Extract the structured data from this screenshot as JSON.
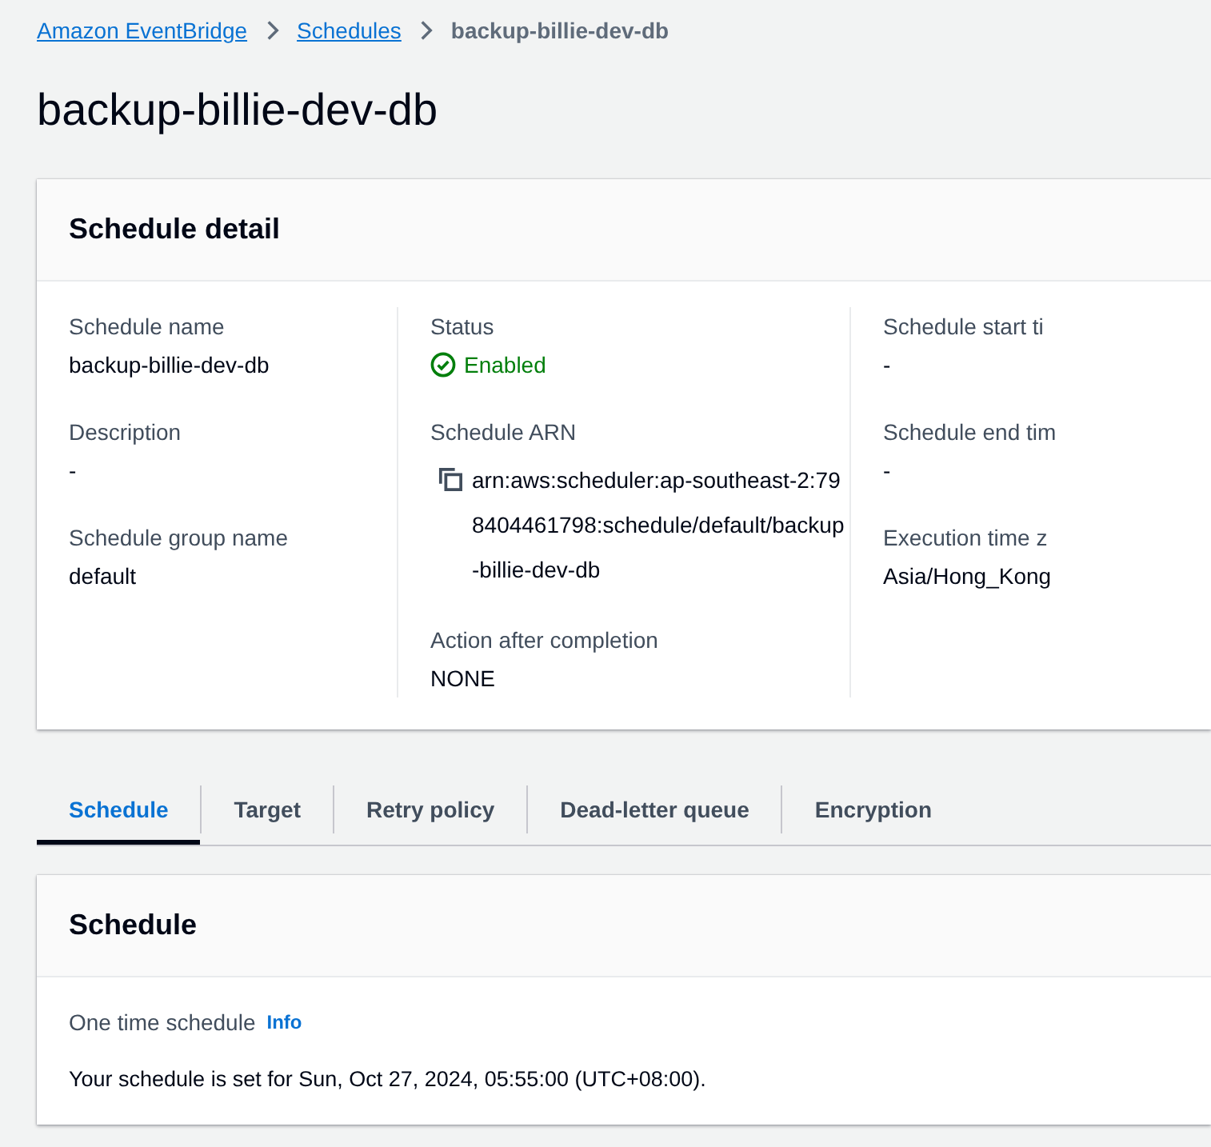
{
  "breadcrumbs": [
    {
      "label": "Amazon EventBridge",
      "kind": "link"
    },
    {
      "label": "Schedules",
      "kind": "link"
    },
    {
      "label": "backup-billie-dev-db",
      "kind": "current"
    }
  ],
  "page_title": "backup-billie-dev-db",
  "detail_card": {
    "title": "Schedule detail",
    "columns": [
      [
        {
          "label": "Schedule name",
          "value": "backup-billie-dev-db",
          "kind": "text"
        },
        {
          "label": "Description",
          "value": "-",
          "kind": "text"
        },
        {
          "label": "Schedule group name",
          "value": "default",
          "kind": "text"
        }
      ],
      [
        {
          "label": "Status",
          "value": "Enabled",
          "kind": "status"
        },
        {
          "label": "Schedule ARN",
          "value": "arn:aws:scheduler:ap-southeast-2:798404461798:schedule/default/backup-billie-dev-db",
          "kind": "copy"
        },
        {
          "label": "Action after completion",
          "value": "NONE",
          "kind": "text"
        }
      ],
      [
        {
          "label": "Schedule start ti",
          "value": "-",
          "kind": "text"
        },
        {
          "label": "Schedule end tim",
          "value": "-",
          "kind": "text"
        },
        {
          "label": "Execution time z",
          "value": "Asia/Hong_Kong",
          "kind": "text"
        }
      ]
    ]
  },
  "tabs": [
    {
      "label": "Schedule",
      "selected": true
    },
    {
      "label": "Target",
      "selected": false
    },
    {
      "label": "Retry policy",
      "selected": false
    },
    {
      "label": "Dead-letter queue",
      "selected": false
    },
    {
      "label": "Encryption",
      "selected": false
    }
  ],
  "schedule_card": {
    "title": "Schedule",
    "field_label": "One time schedule",
    "info_link": "Info",
    "text": "Your schedule is set for Sun, Oct 27, 2024, 05:55:00 (UTC+08:00)."
  }
}
